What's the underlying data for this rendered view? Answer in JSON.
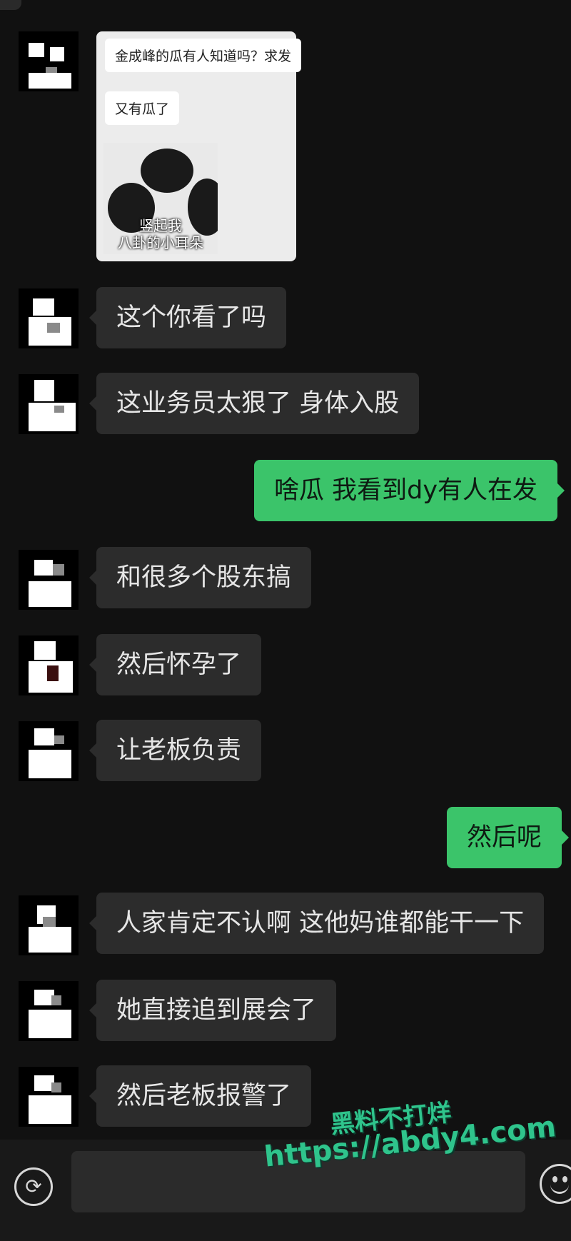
{
  "quote": {
    "line1": "金成峰的瓜有人知道吗？求发",
    "line2": "又有瓜了",
    "sticker_caption_1": "竖起我",
    "sticker_caption_2": "八卦的小耳朵"
  },
  "messages": [
    {
      "side": "left",
      "text": "这个你看了吗"
    },
    {
      "side": "left",
      "text": "这业务员太狠了 身体入股"
    },
    {
      "side": "right",
      "text": "啥瓜 我看到dy有人在发"
    },
    {
      "side": "left",
      "text": "和很多个股东搞"
    },
    {
      "side": "left",
      "text": "然后怀孕了"
    },
    {
      "side": "left",
      "text": "让老板负责"
    },
    {
      "side": "right",
      "text": "然后呢"
    },
    {
      "side": "left",
      "text": "人家肯定不认啊 这他妈谁都能干一下"
    },
    {
      "side": "left",
      "text": "她直接追到展会了"
    },
    {
      "side": "left",
      "text": "然后老板报警了"
    }
  ],
  "input_bar": {
    "voice_icon": "voice-icon",
    "emoji_icon": "emoji-icon",
    "message_value": ""
  },
  "watermark": {
    "line1": "黑料不打烊",
    "line2": "https://abdy4.com"
  },
  "colors": {
    "background": "#111111",
    "incoming_bubble": "#2c2c2c",
    "outgoing_bubble": "#3bc46a",
    "watermark": "#2fc48c"
  }
}
